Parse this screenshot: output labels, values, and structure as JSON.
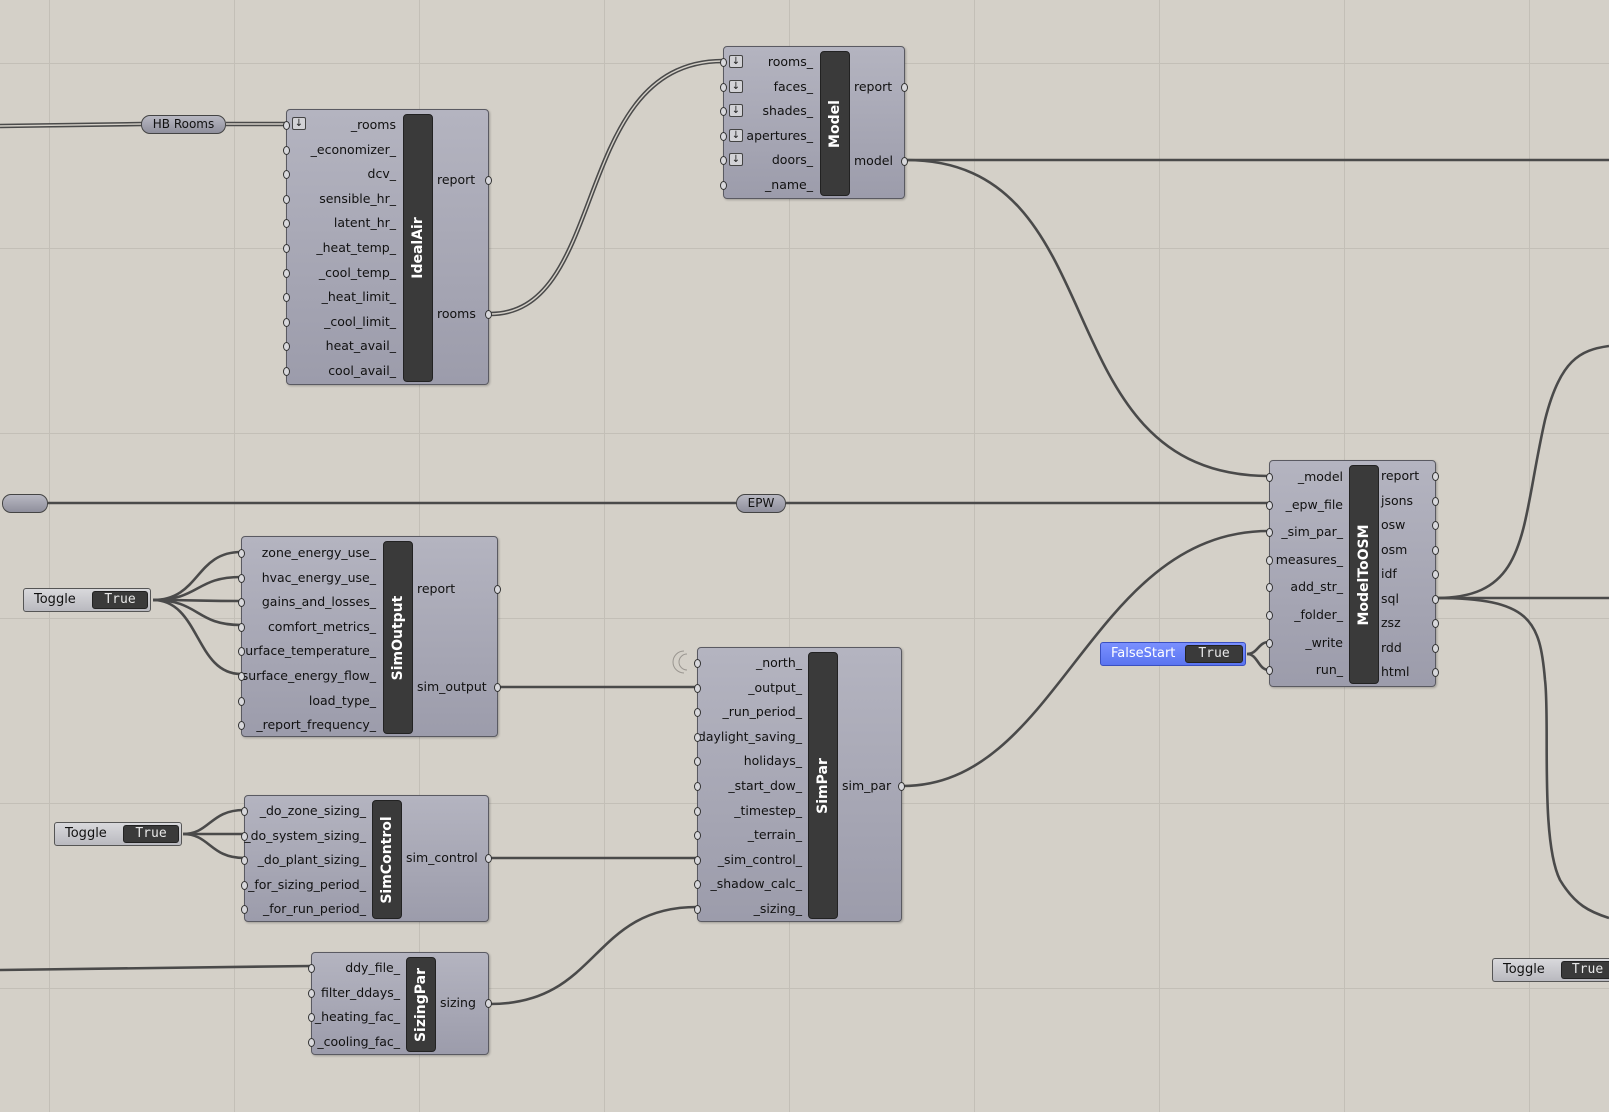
{
  "relays": {
    "hb_rooms": "HB Rooms",
    "epw": "EPW",
    "epw_source": ""
  },
  "ideal_air": {
    "nickname": "IdealAir",
    "inputs": [
      "_rooms",
      "_economizer_",
      "dcv_",
      "sensible_hr_",
      "latent_hr_",
      "_heat_temp_",
      "_cool_temp_",
      "_heat_limit_",
      "_cool_limit_",
      "heat_avail_",
      "cool_avail_"
    ],
    "outputs": [
      "report",
      "rooms"
    ]
  },
  "model": {
    "nickname": "Model",
    "inputs": [
      "rooms_",
      "faces_",
      "shades_",
      "apertures_",
      "doors_",
      "_name_"
    ],
    "outputs": [
      "report",
      "model"
    ]
  },
  "model_to_osm": {
    "nickname": "ModelToOSM",
    "inputs": [
      "_model",
      "_epw_file",
      "_sim_par_",
      "measures_",
      "add_str_",
      "_folder_",
      "_write",
      "run_"
    ],
    "outputs": [
      "report",
      "jsons",
      "osw",
      "osm",
      "idf",
      "sql",
      "zsz",
      "rdd",
      "html"
    ]
  },
  "sim_output": {
    "nickname": "SimOutput",
    "inputs": [
      "zone_energy_use_",
      "hvac_energy_use_",
      "gains_and_losses_",
      "comfort_metrics_",
      "surface_temperature_",
      "surface_energy_flow_",
      "load_type_",
      "_report_frequency_"
    ],
    "outputs": [
      "report",
      "sim_output"
    ]
  },
  "sim_par": {
    "nickname": "SimPar",
    "inputs": [
      "_north_",
      "_output_",
      "_run_period_",
      "daylight_saving_",
      "holidays_",
      "_start_dow_",
      "_timestep_",
      "_terrain_",
      "_sim_control_",
      "_shadow_calc_",
      "_sizing_"
    ],
    "outputs": [
      "sim_par"
    ]
  },
  "sim_control": {
    "nickname": "SimControl",
    "inputs": [
      "_do_zone_sizing_",
      "_do_system_sizing_",
      "_do_plant_sizing_",
      "_for_sizing_period_",
      "_for_run_period_"
    ],
    "outputs": [
      "sim_control"
    ]
  },
  "sizing_par": {
    "nickname": "SizingPar",
    "inputs": [
      "ddy_file_",
      "filter_ddays_",
      "_heating_fac_",
      "_cooling_fac_"
    ],
    "outputs": [
      "sizing"
    ]
  },
  "toggles": {
    "sim_output_toggle": {
      "label": "Toggle",
      "value": "True"
    },
    "sim_control_toggle": {
      "label": "Toggle",
      "value": "True"
    },
    "false_start_toggle": {
      "label": "FalseStart",
      "value": "True"
    },
    "right_toggle": {
      "label": "Toggle",
      "value": "True"
    }
  },
  "colors": {
    "canvas": "#d4d0c8",
    "grid": "#c3bfb7",
    "component": "#a8a8b6",
    "wire": "#4a4a4a",
    "false_start": "#6a82f8"
  }
}
